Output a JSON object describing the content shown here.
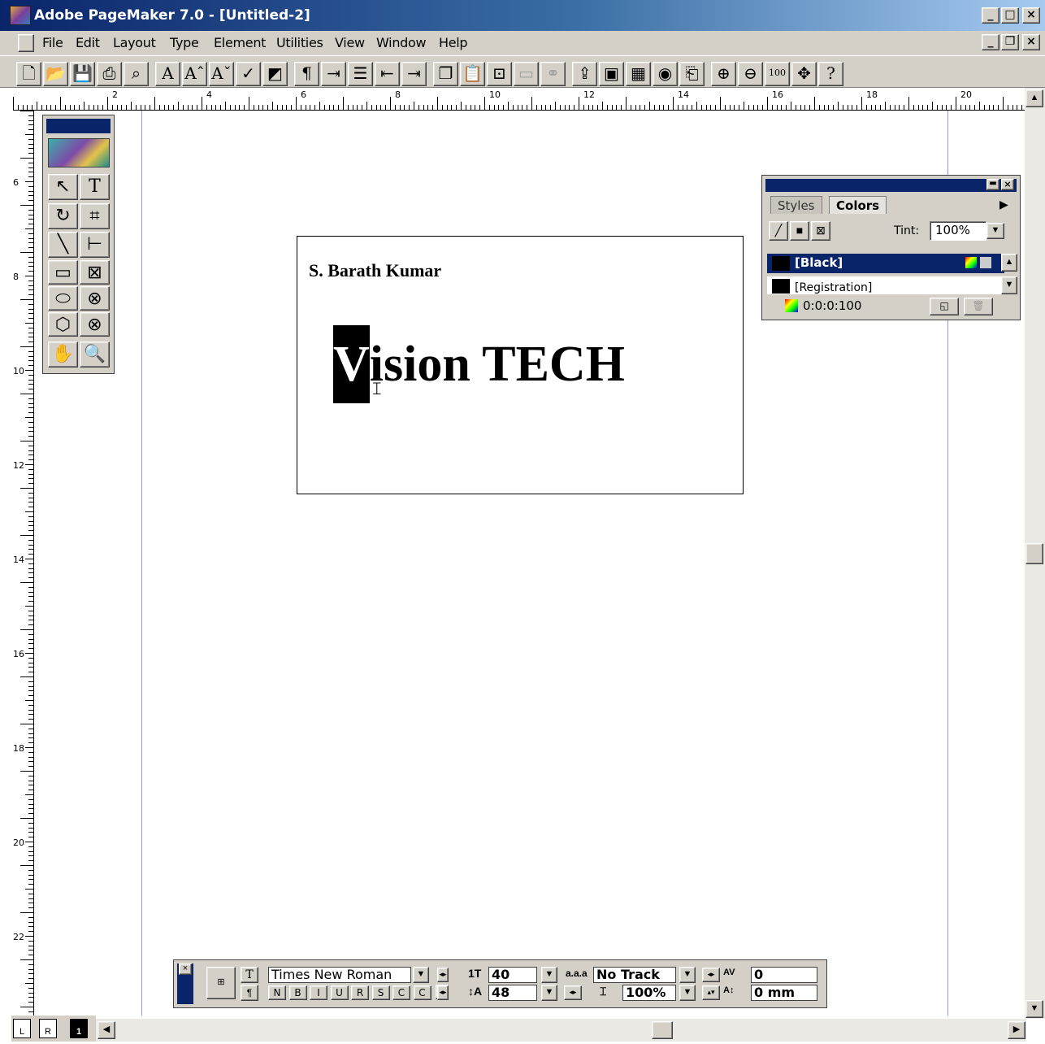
{
  "window": {
    "title": "Adobe PageMaker 7.0 - [Untitled-2]",
    "controls": {
      "minimize": "_",
      "maximize": "□",
      "close": "×",
      "doc_restore": "❐"
    }
  },
  "menu": [
    "File",
    "Edit",
    "Layout",
    "Type",
    "Element",
    "Utilities",
    "View",
    "Window",
    "Help"
  ],
  "toolbar_buttons": [
    {
      "name": "new-icon",
      "glyph": "🗋"
    },
    {
      "name": "open-icon",
      "glyph": "📂"
    },
    {
      "name": "save-icon",
      "glyph": "💾"
    },
    {
      "name": "print-icon",
      "glyph": "⎙"
    },
    {
      "name": "find-icon",
      "glyph": "⌕"
    },
    {
      "name": "font-icon",
      "glyph": "A"
    },
    {
      "name": "font-larger-icon",
      "glyph": "Aˆ"
    },
    {
      "name": "font-smaller-icon",
      "glyph": "Aˇ"
    },
    {
      "name": "spelling-icon",
      "glyph": "✓"
    },
    {
      "name": "fill-icon",
      "glyph": "◩"
    },
    {
      "name": "paragraph-icon",
      "glyph": "¶"
    },
    {
      "name": "indent-tabs-icon",
      "glyph": "⇥"
    },
    {
      "name": "bullets-icon",
      "glyph": "☰"
    },
    {
      "name": "decrease-indent-icon",
      "glyph": "⇤"
    },
    {
      "name": "increase-indent-icon",
      "glyph": "⇥"
    },
    {
      "name": "copy-icon",
      "glyph": "❐"
    },
    {
      "name": "paste-icon",
      "glyph": "📋"
    },
    {
      "name": "place-icon",
      "glyph": "⊡"
    },
    {
      "name": "frame-icon",
      "glyph": "▭"
    },
    {
      "name": "link-icon",
      "glyph": "⚭"
    },
    {
      "name": "export-icon",
      "glyph": "⇪"
    },
    {
      "name": "photo-icon",
      "glyph": "▣"
    },
    {
      "name": "image-icon",
      "glyph": "▦"
    },
    {
      "name": "web-icon",
      "glyph": "◉"
    },
    {
      "name": "pdf-icon",
      "glyph": "⎗"
    },
    {
      "name": "zoom-in-icon",
      "glyph": "⊕"
    },
    {
      "name": "zoom-out-icon",
      "glyph": "⊖"
    },
    {
      "name": "actual-size-icon",
      "glyph": "100"
    },
    {
      "name": "fit-icon",
      "glyph": "✥"
    },
    {
      "name": "help-icon",
      "glyph": "?"
    }
  ],
  "rulers": {
    "horizontal_labels": [
      "2",
      "4",
      "6",
      "8",
      "10",
      "12",
      "14",
      "16",
      "18",
      "20"
    ],
    "vertical_labels": [
      "6",
      "8",
      "10",
      "12",
      "14",
      "16",
      "18",
      "20",
      "22"
    ]
  },
  "toolbox": {
    "tools": [
      {
        "name": "pointer-tool-icon",
        "glyph": "↖"
      },
      {
        "name": "text-tool-icon",
        "glyph": "T"
      },
      {
        "name": "rotate-tool-icon",
        "glyph": "↻"
      },
      {
        "name": "crop-tool-icon",
        "glyph": "⌗"
      },
      {
        "name": "line-tool-icon",
        "glyph": "╲"
      },
      {
        "name": "constrained-line-tool-icon",
        "glyph": "⊢"
      },
      {
        "name": "rectangle-tool-icon",
        "glyph": "▭"
      },
      {
        "name": "rectangle-frame-tool-icon",
        "glyph": "⊠"
      },
      {
        "name": "ellipse-tool-icon",
        "glyph": "⬭"
      },
      {
        "name": "ellipse-frame-tool-icon",
        "glyph": "⊗"
      },
      {
        "name": "polygon-tool-icon",
        "glyph": "⬡"
      },
      {
        "name": "polygon-frame-tool-icon",
        "glyph": "⊗"
      },
      {
        "name": "hand-tool-icon",
        "glyph": "✋"
      },
      {
        "name": "zoom-tool-icon",
        "glyph": "🔍"
      }
    ]
  },
  "document": {
    "author": "S. Barath Kumar",
    "headline_selected": "V",
    "headline_rest": "ision TECH"
  },
  "colors_palette": {
    "tabs": [
      "Styles",
      "Colors"
    ],
    "tint_label": "Tint:",
    "tint_value": "100%",
    "swatches": [
      "[Black]",
      "[Registration]"
    ],
    "cmyk_readout": "0:0:0:100"
  },
  "control_palette": {
    "font": "Times New Roman",
    "size": "40",
    "leading": "48",
    "track": "No Track",
    "width": "100%",
    "kerning": "0",
    "baseline_shift": "0 mm",
    "style_buttons": [
      "N",
      "B",
      "I",
      "U",
      "R",
      "S",
      "C",
      "C"
    ]
  },
  "page_icons": [
    "L",
    "R",
    "1"
  ],
  "colors": {
    "title_gradient_start": "#0a246a",
    "title_gradient_end": "#a6caf0",
    "chrome": "#d4d0c8",
    "guide": "#9999cc"
  }
}
